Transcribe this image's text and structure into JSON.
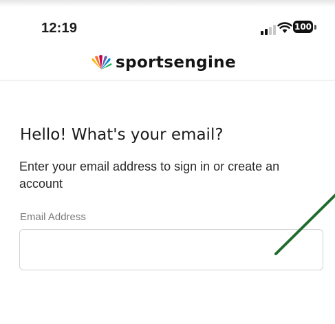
{
  "status_bar": {
    "time": "12:19",
    "battery_level": "100",
    "icons": [
      "signal-icon",
      "wifi-icon",
      "battery-icon"
    ]
  },
  "brand": {
    "name": "sportsengine",
    "logo_icon": "peacock-icon"
  },
  "signin": {
    "heading": "Hello! What's your email?",
    "subtext": "Enter your email address to sign in or create an account",
    "email_label": "Email Address",
    "email_value": "",
    "email_placeholder": ""
  },
  "colors": {
    "annotation_line": "#1e6b2e",
    "input_border": "#d2d2d2",
    "label_gray": "#7a7a7a"
  }
}
